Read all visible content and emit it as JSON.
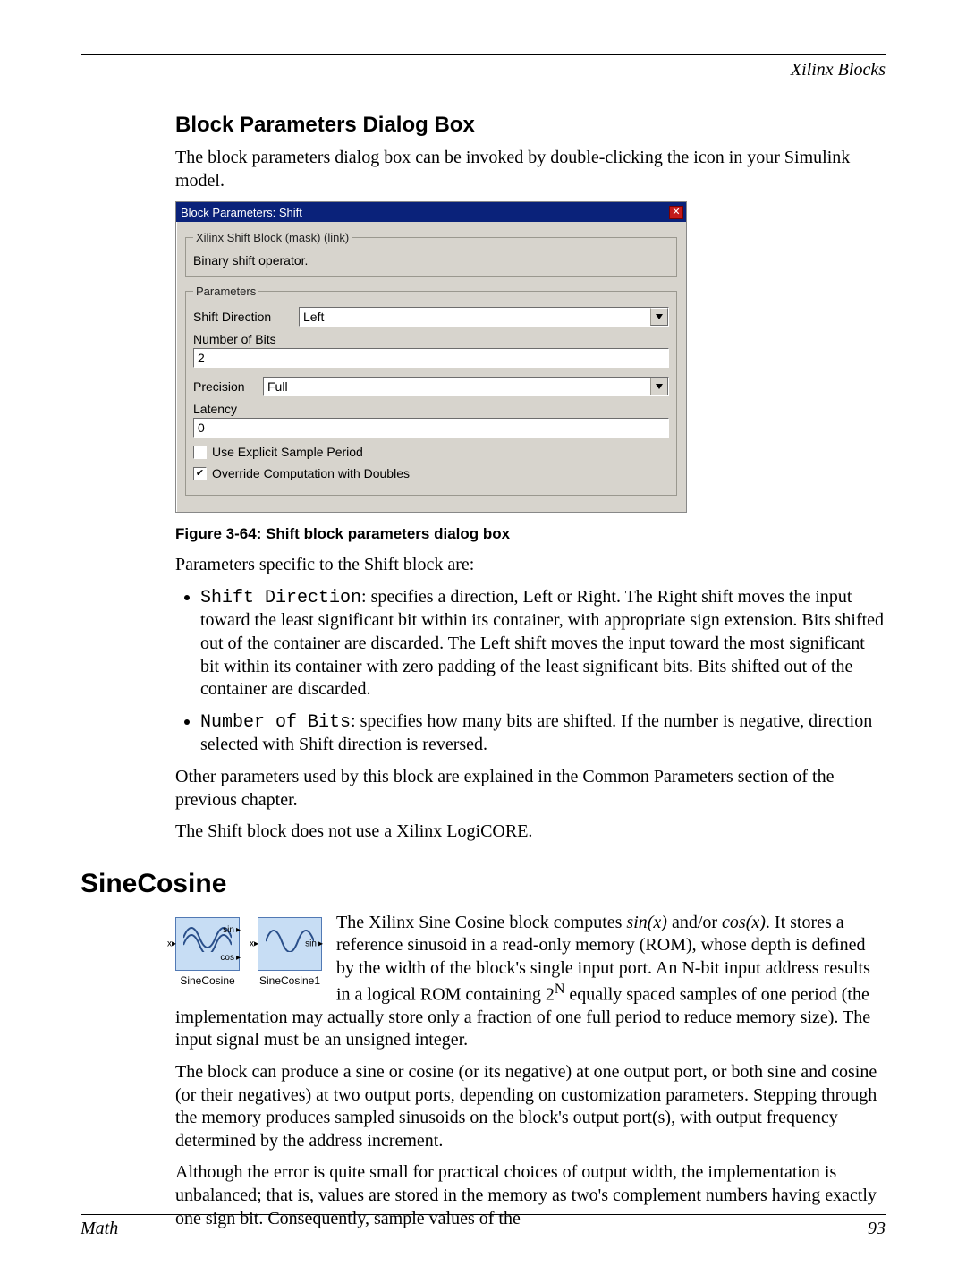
{
  "running_head": "Xilinx Blocks",
  "section_title": "Block Parameters Dialog Box",
  "section_intro": "The block parameters dialog box can be invoked by double-clicking the icon in your Simulink model.",
  "dialog": {
    "title": "Block Parameters: Shift",
    "mask_group": {
      "legend": "Xilinx Shift Block (mask) (link)",
      "description": "Binary shift operator."
    },
    "params_group": {
      "legend": "Parameters",
      "shift_direction": {
        "label": "Shift Direction",
        "value": "Left"
      },
      "number_of_bits": {
        "label": "Number of Bits",
        "value": "2"
      },
      "precision": {
        "label": "Precision",
        "value": "Full"
      },
      "latency": {
        "label": "Latency",
        "value": "0"
      },
      "explicit_sample_period": {
        "label": "Use Explicit Sample Period",
        "checked": false
      },
      "override_doubles": {
        "label": "Override Computation with Doubles",
        "checked": true
      }
    }
  },
  "figure_caption": "Figure 3-64:   Shift block parameters dialog box",
  "after_figure_intro": "Parameters specific to the Shift block are:",
  "bullet_shift_direction": {
    "code": "Shift Direction",
    "text": ": specifies a direction, Left or Right. The Right shift moves the input toward the least significant bit within its container, with appropriate sign extension. Bits shifted out of the container are discarded. The Left shift moves the input toward the most significant bit within its container with zero padding of the least significant bits. Bits shifted out of the container are discarded."
  },
  "bullet_number_of_bits": {
    "code": "Number of Bits",
    "text": ": specifies how many bits are shifted. If the number is negative, direction selected with Shift direction is reversed."
  },
  "other_params_text": "Other parameters used by this block are explained in the Common Parameters section of the previous chapter.",
  "no_logicore_text": "The Shift block does not use a Xilinx LogiCORE.",
  "sinecosine": {
    "heading": "SineCosine",
    "icon1_label": "SineCosine",
    "icon2_label": "SineCosine1",
    "port_sin": "sin",
    "port_cos": "cos",
    "port_x": "x",
    "intro_prefix": "The Xilinx Sine Cosine block computes ",
    "intro_sinx": "sin(x)",
    "intro_andor": " and/or ",
    "intro_cosx": "cos(x)",
    "intro_rest_a": ". It stores a reference sinusoid in a read-only memory (ROM), whose depth is defined by the width of the block's single input port.  An N-bit input address results in a logical ROM containing 2",
    "intro_exp": "N",
    "intro_rest_b": " equally spaced samples of one period (the implementation may actually store only a fraction of one full period to reduce memory size). The input signal must be an unsigned integer.",
    "para2": "The block can produce a sine or cosine (or its negative) at one output port, or both sine and cosine (or their negatives) at two output ports, depending on customization parameters. Stepping through the memory produces sampled sinusoids on the block's output port(s), with output frequency determined by the address increment.",
    "para3": "Although the error is quite small for practical choices of output width, the implementation is unbalanced; that is, values are stored in the memory as two's complement numbers having exactly one sign bit.  Consequently, sample values of the"
  },
  "footer": {
    "left": "Math",
    "right": "93"
  }
}
